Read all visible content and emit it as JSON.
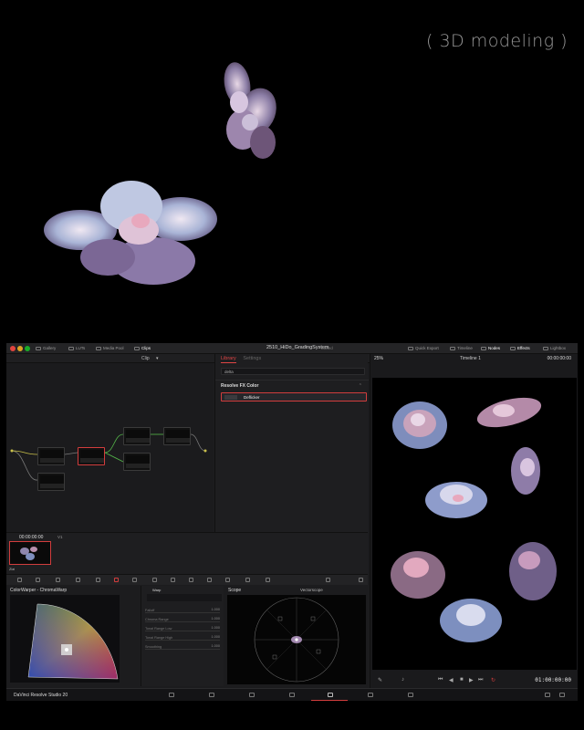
{
  "caption": "( 3D modeling )",
  "app": {
    "top_tabs_left": [
      "Gallery",
      "LUTs",
      "Media Pool",
      "Clips"
    ],
    "project_title": "2510_HiDo_GradingSystem",
    "project_status": "Edited",
    "top_tabs_right": [
      "Quick Export",
      "Timeline",
      "Nodes",
      "Effects",
      "Lightbox"
    ],
    "node_editor": {
      "mode": "Clip"
    },
    "library": {
      "tabs": [
        "Library",
        "Settings"
      ],
      "search_value": "delta",
      "section": "Resolve FX Color",
      "item": "Deflicker"
    },
    "viewer": {
      "zoom": "25%",
      "timeline_name": "Timeline 1",
      "timecode": "00:00:00:00",
      "playhead_timecode": "01:00:00:00"
    },
    "clip_strip": {
      "timecode": "00:00:00:00",
      "track": "V1",
      "clip_name": "Zizi"
    },
    "color_warper": {
      "title": "ColorWarper - ChromaWarp",
      "tab": "Warp",
      "params": [
        {
          "label": "Falloff",
          "value": "1.000"
        },
        {
          "label": "Chroma Range",
          "value": "1.000"
        },
        {
          "label": "Tonal Range Low",
          "value": "1.000"
        },
        {
          "label": "Tonal Range High",
          "value": "1.000"
        },
        {
          "label": "Smoothing",
          "value": "1.000"
        }
      ]
    },
    "scope": {
      "title": "Scope",
      "mode": "Vectorscope"
    },
    "brand": "DaVinci Resolve Studio 20"
  },
  "colors": {
    "accent_red": "#d23d3d",
    "panel_bg": "#1c1c1e",
    "flower_pink": "#c88fa8",
    "flower_blue": "#7d8fbf"
  }
}
